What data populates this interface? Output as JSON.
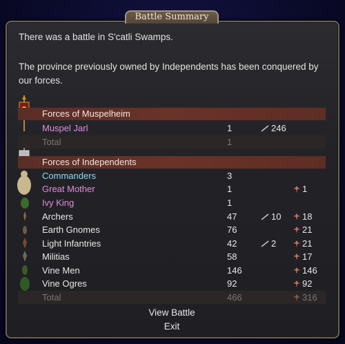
{
  "window": {
    "title": "Battle Summary"
  },
  "intro": {
    "line1": "There was a battle in S'catli Swamps.",
    "line2": "The province previously owned by Independents has been conquered by our forces."
  },
  "sections": [
    {
      "header": "Forces of Muspelheim",
      "rows": [
        {
          "name": "Muspel Jarl",
          "count": "1",
          "kills": "246",
          "losses": "",
          "color": "pink"
        }
      ],
      "total": {
        "label": "Total",
        "count": "1",
        "kills": "",
        "losses": ""
      }
    },
    {
      "header": "Forces of Independents",
      "rows": [
        {
          "name": "Commanders",
          "count": "3",
          "kills": "",
          "losses": "",
          "color": "blue"
        },
        {
          "name": "Great Mother",
          "count": "1",
          "kills": "",
          "losses": "1",
          "color": "pink"
        },
        {
          "name": "Ivy King",
          "count": "1",
          "kills": "",
          "losses": "",
          "color": "pink"
        },
        {
          "name": "Archers",
          "count": "47",
          "kills": "10",
          "losses": "18",
          "color": "white"
        },
        {
          "name": "Earth Gnomes",
          "count": "76",
          "kills": "",
          "losses": "21",
          "color": "white"
        },
        {
          "name": "Light Infantries",
          "count": "42",
          "kills": "2",
          "losses": "21",
          "color": "white"
        },
        {
          "name": "Militias",
          "count": "58",
          "kills": "",
          "losses": "17",
          "color": "white"
        },
        {
          "name": "Vine Men",
          "count": "146",
          "kills": "",
          "losses": "146",
          "color": "white"
        },
        {
          "name": "Vine Ogres",
          "count": "92",
          "kills": "",
          "losses": "92",
          "color": "white"
        }
      ],
      "total": {
        "label": "Total",
        "count": "466",
        "kills": "",
        "losses": "316"
      }
    }
  ],
  "buttons": {
    "view_battle": "View Battle",
    "exit": "Exit"
  },
  "icons": {
    "kills": "sword-icon",
    "losses": "death-icon"
  }
}
